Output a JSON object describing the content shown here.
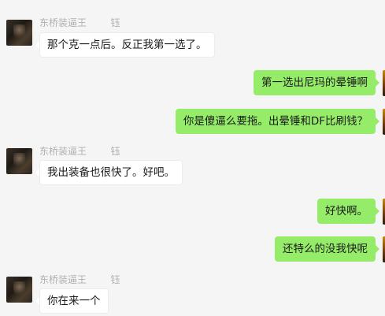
{
  "messages": [
    {
      "side": "in",
      "sender": "东桥装逼王        钰",
      "text": "那个克一点后。反正我第一选了。"
    },
    {
      "side": "out",
      "text": "第一选出尼玛的晕锤啊"
    },
    {
      "side": "out",
      "text": "你是傻逼么要拖。出晕锤和DF比刷钱？"
    },
    {
      "side": "in",
      "sender": "东桥装逼王        钰",
      "text": "我出装备也很快了。好吧。"
    },
    {
      "side": "out",
      "text": "好快啊。"
    },
    {
      "side": "out",
      "text": "还特么的没我快呢"
    },
    {
      "side": "in",
      "sender": "东桥装逼王        钰",
      "text": "你在来一个"
    }
  ]
}
